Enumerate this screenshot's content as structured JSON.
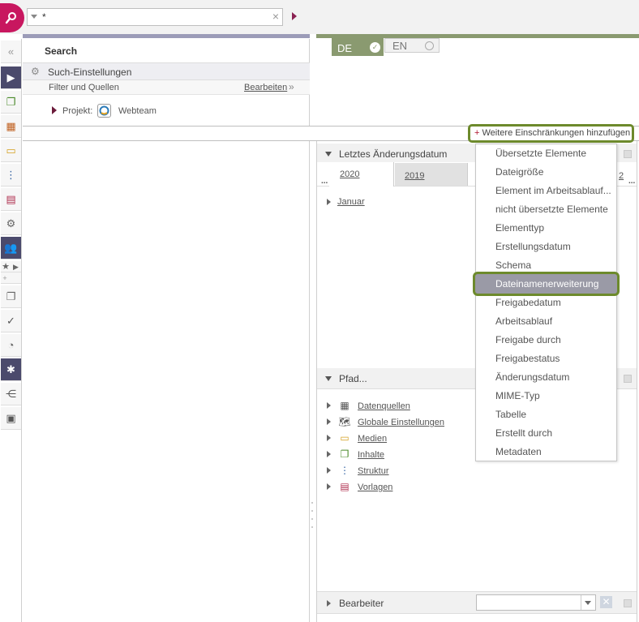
{
  "topbar": {
    "search_value": "*",
    "clear_icon": "×"
  },
  "search_panel": {
    "collapse_icon": "«",
    "title": "Search",
    "settings_title": "Such-Einstellungen",
    "filter_label": "Filter und Quellen",
    "edit_label": "Bearbeiten",
    "edit_chevron": "»",
    "project_label": "Projekt:",
    "project_name": "Webteam"
  },
  "lang_tabs": {
    "de": "DE",
    "en": "EN"
  },
  "add_restrictions": {
    "plus": "+",
    "label": "Weitere Einschränkungen hinzufügen"
  },
  "sections": {
    "last_modified": "Letztes Änderungsdatum",
    "path": "Pfad...",
    "editor": "Bearbeiter"
  },
  "years": {
    "more_left": "...",
    "y2020": "2020",
    "y2019": "2019",
    "more_right": "...",
    "partial": "2"
  },
  "month": "Januar",
  "path_items": [
    {
      "label": "Datenquellen",
      "icon": "datasource-icon"
    },
    {
      "label": "Globale Einstellungen",
      "icon": "globe-icon"
    },
    {
      "label": "Medien",
      "icon": "media-icon"
    },
    {
      "label": "Inhalte",
      "icon": "content-icon"
    },
    {
      "label": "Struktur",
      "icon": "structure-icon"
    },
    {
      "label": "Vorlagen",
      "icon": "template-icon"
    }
  ],
  "dropdown": {
    "items": [
      "Übersetzte Elemente",
      "Dateigröße",
      "Element im Arbeitsablauf...",
      "nicht übersetzte Elemente",
      "Elementtyp",
      "Erstellungsdatum",
      "Schema",
      "Dateinamenerweiterung",
      "Freigabedatum",
      "Arbeitsablauf",
      "Freigabe durch",
      "Freigabestatus",
      "Änderungsdatum",
      "MIME-Typ",
      "Tabelle",
      "Erstellt durch",
      "Metadaten"
    ],
    "selected": "Dateinamenerweiterung"
  },
  "colors": {
    "brand": "#c8175f",
    "accent_green": "#6d8a2c",
    "rail_dark": "#4b4a6c"
  }
}
